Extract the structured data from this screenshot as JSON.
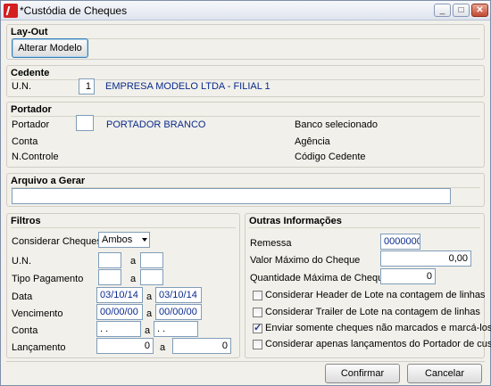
{
  "window": {
    "title": "*Custódia de Cheques"
  },
  "layout_group": {
    "title": "Lay-Out",
    "alter_button": "Alterar Modelo"
  },
  "cedente": {
    "title": "Cedente",
    "un_label": "U.N.",
    "un_value": "1",
    "company": "EMPRESA MODELO LTDA - FILIAL 1"
  },
  "portador": {
    "title": "Portador",
    "portador_label": "Portador",
    "portador_value": "",
    "portador_name": "PORTADOR BRANCO",
    "conta_label": "Conta",
    "ncontrole_label": "N.Controle",
    "banco_label": "Banco selecionado",
    "agencia_label": "Agência",
    "codigo_label": "Código Cedente"
  },
  "arquivo": {
    "title": "Arquivo a Gerar",
    "value": ""
  },
  "filtros": {
    "title": "Filtros",
    "considerar_label": "Considerar Cheques",
    "considerar_value": "Ambos",
    "un_label": "U.N.",
    "tipo_label": "Tipo Pagamento",
    "data_label": "Data",
    "data_from": "03/10/14",
    "data_to": "03/10/14",
    "venc_label": "Vencimento",
    "venc_from": "00/00/00",
    "venc_to": "00/00/00",
    "conta_label": "Conta",
    "conta_from": " .  .",
    "conta_to": " .  .",
    "lanc_label": "Lançamento",
    "lanc_from": "0",
    "lanc_to": "0",
    "a": "a"
  },
  "outras": {
    "title": "Outras Informações",
    "remessa_label": "Remessa",
    "remessa_value": "0000000",
    "valor_label": "Valor Máximo do Cheque",
    "valor_value": "0,00",
    "qtd_label": "Quantidade Máxima de Cheques",
    "qtd_value": "0",
    "opt1": "Considerar Header de Lote na contagem de linhas",
    "opt2": "Considerar Trailer de Lote na contagem de linhas",
    "opt3": "Enviar somente cheques não marcados e marcá-los",
    "opt4": "Considerar apenas lançamentos do Portador de custódia",
    "opt1_checked": false,
    "opt2_checked": false,
    "opt3_checked": true,
    "opt4_checked": false
  },
  "footer": {
    "confirm": "Confirmar",
    "cancel": "Cancelar"
  }
}
